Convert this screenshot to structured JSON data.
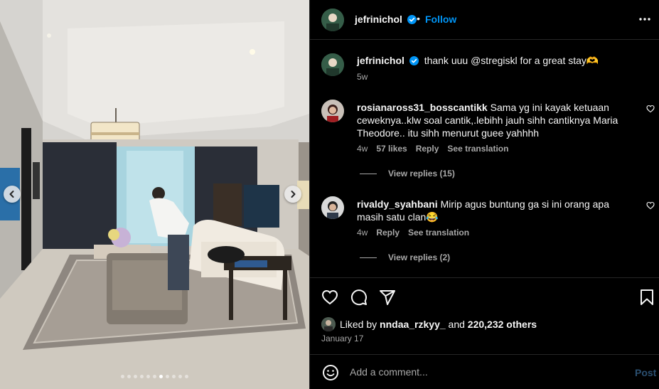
{
  "header": {
    "username": "jefrinichol",
    "separator": "•",
    "follow_label": "Follow"
  },
  "carousel": {
    "total_slides": 11,
    "active_slide": 6
  },
  "caption": {
    "username": "jefrinichol",
    "text": "thank uuu @stregiskl for a great stay🫶",
    "time": "5w"
  },
  "comments": [
    {
      "username": "rosianaross31_bosscantikk",
      "text": "Sama yg ini kayak ketuaan ceweknya..klw soal cantik,.lebihh jauh sihh cantiknya Maria Theodore.. itu sihh menurut guee yahhhh",
      "time": "4w",
      "likes": "57 likes",
      "reply_label": "Reply",
      "translate_label": "See translation",
      "view_replies": "View replies (15)"
    },
    {
      "username": "rivaldy_syahbani",
      "text": "Mirip agus buntung ga si ini orang apa masih satu clan😂",
      "time": "4w",
      "reply_label": "Reply",
      "translate_label": "See translation",
      "view_replies": "View replies (2)"
    }
  ],
  "likes": {
    "prefix": "Liked by",
    "user": "nndaa_rzkyy_",
    "joiner": "and",
    "others": "220,232 others"
  },
  "date": "January 17",
  "add_comment": {
    "placeholder": "Add a comment...",
    "post_label": "Post"
  },
  "colors": {
    "accent_blue": "#0095f6",
    "post_disabled": "#2b4f70",
    "muted_text": "#a8a8a8",
    "border": "#262626"
  }
}
